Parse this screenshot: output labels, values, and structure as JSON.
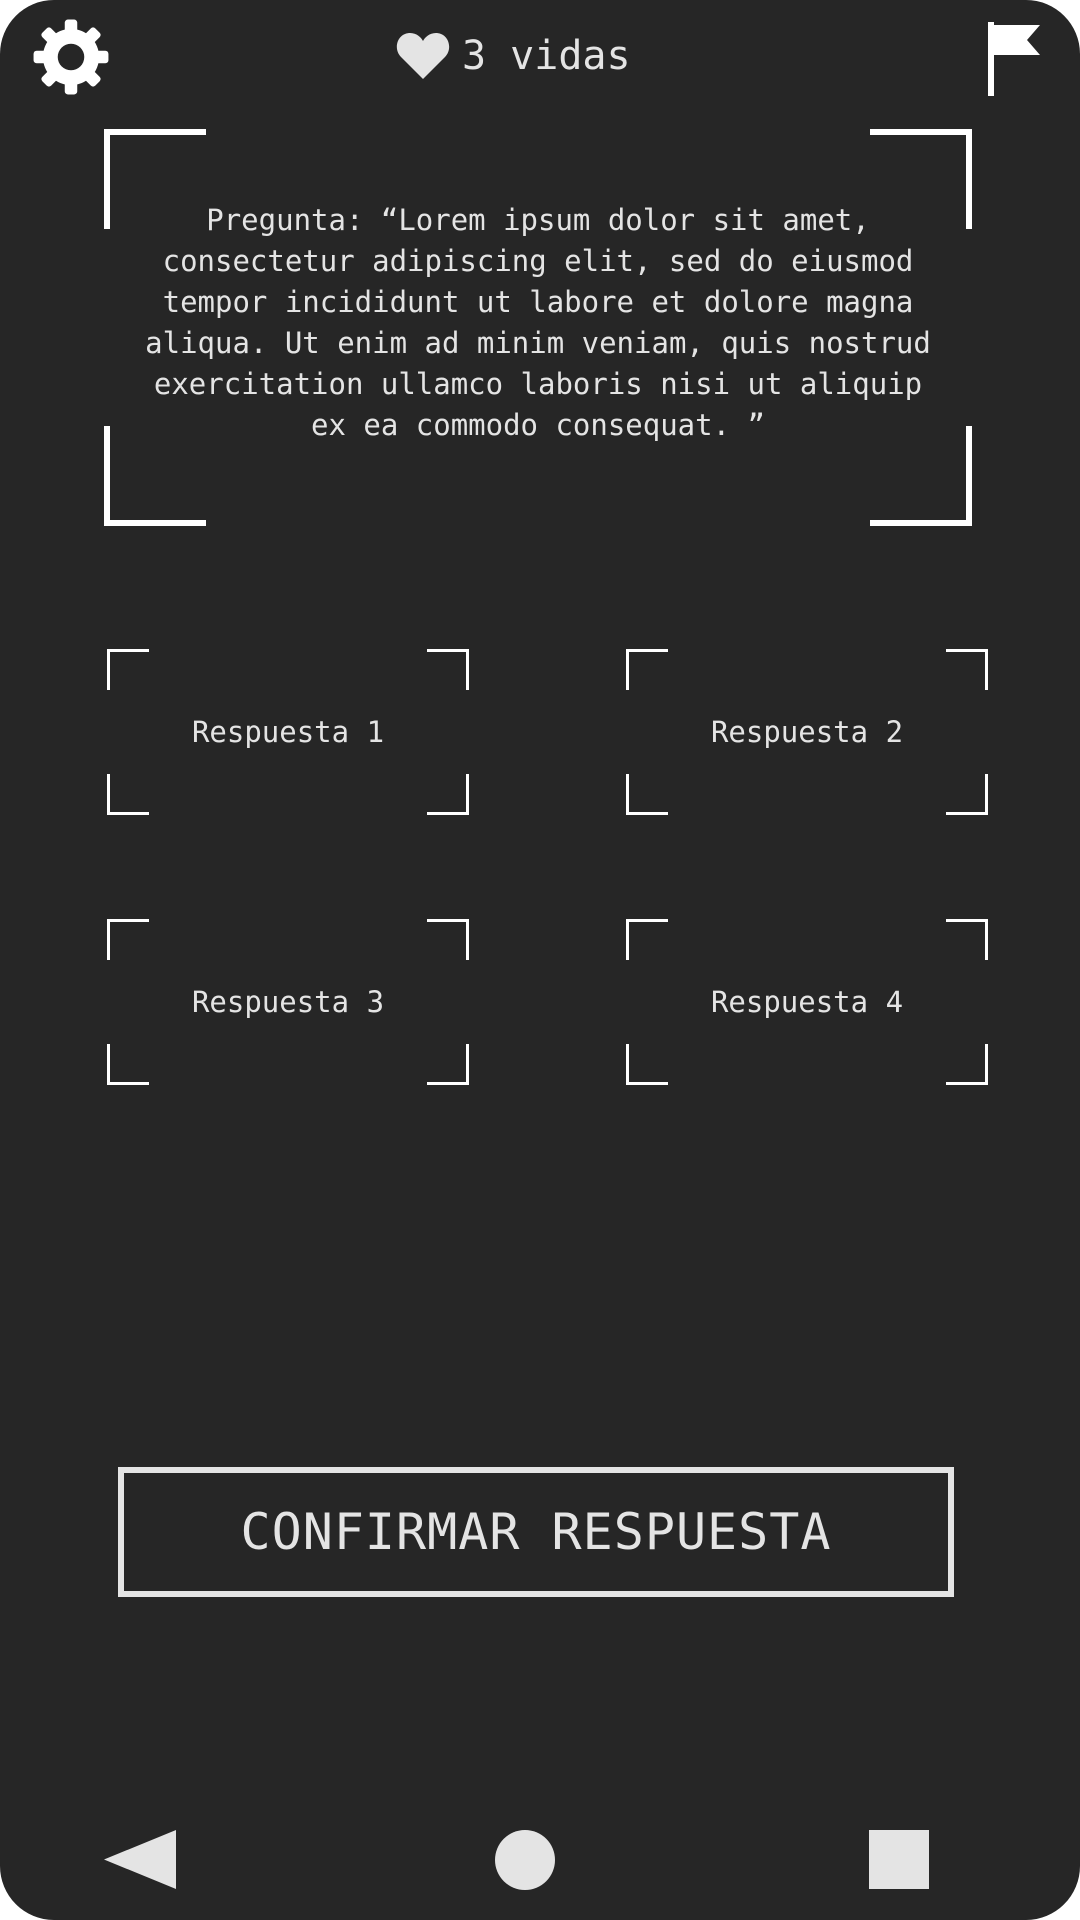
{
  "header": {
    "settings_icon": "gear-icon",
    "lives_icon": "heart-icon",
    "lives_text": "3 vidas",
    "flag_icon": "flag-icon"
  },
  "question": {
    "text": "Pregunta: “Lorem ipsum dolor sit amet, consectetur adipiscing elit, sed do eiusmod tempor incididunt ut labore et dolore magna aliqua. Ut enim ad minim veniam, quis nostrud exercitation ullamco laboris nisi ut aliquip ex ea commodo consequat. ”"
  },
  "answers": [
    {
      "label": "Respuesta 1"
    },
    {
      "label": "Respuesta 2"
    },
    {
      "label": "Respuesta 3"
    },
    {
      "label": "Respuesta 4"
    }
  ],
  "confirm": {
    "label": "CONFIRMAR RESPUESTA"
  },
  "navbar": {
    "back_icon": "back-triangle-icon",
    "home_icon": "home-circle-icon",
    "recent_icon": "recents-square-icon"
  },
  "colors": {
    "background": "#262626",
    "foreground": "#e4e4e4",
    "frame": "#ffffff"
  }
}
